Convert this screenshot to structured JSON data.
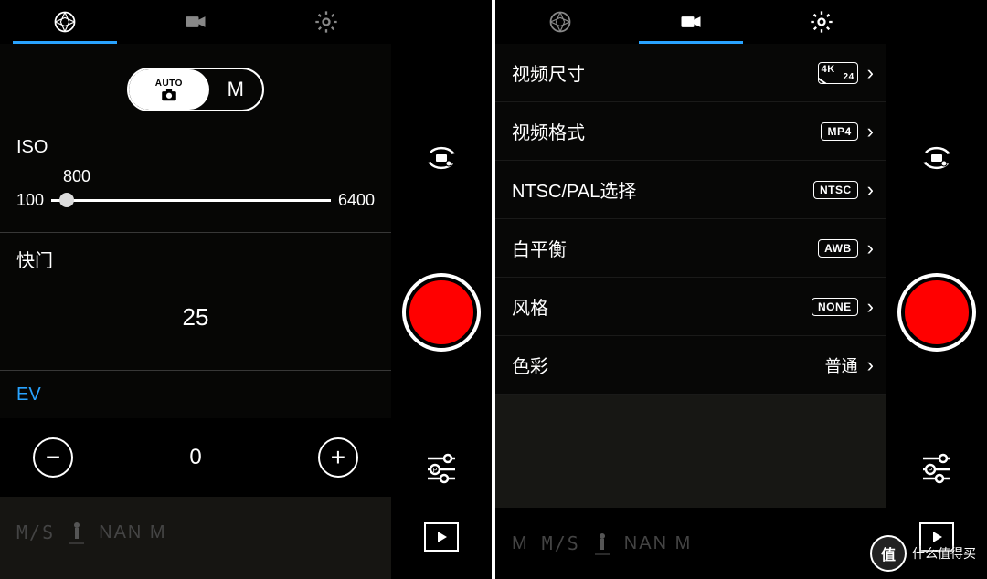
{
  "left": {
    "tabs": {
      "active": "photo"
    },
    "mode": {
      "auto_label": "AUTO",
      "manual_label": "M"
    },
    "iso": {
      "label": "ISO",
      "min": "100",
      "current": "800",
      "max": "6400"
    },
    "shutter": {
      "label": "快门",
      "value": "25"
    },
    "ev": {
      "label": "EV",
      "value": "0"
    }
  },
  "right": {
    "tabs": {
      "active": "video"
    },
    "rows": [
      {
        "label": "视频尺寸",
        "badge_a": "4K",
        "badge_b": "24"
      },
      {
        "label": "视频格式",
        "badge": "MP4"
      },
      {
        "label": "NTSC/PAL选择",
        "badge": "NTSC"
      },
      {
        "label": "白平衡",
        "badge": "AWB"
      },
      {
        "label": "风格",
        "badge": "NONE"
      },
      {
        "label": "色彩",
        "value": "普通"
      }
    ]
  },
  "footer": {
    "m": "M",
    "speed": "M/S",
    "nan": "NAN M"
  },
  "watermark": {
    "logo": "值",
    "text": "什么值得买"
  }
}
